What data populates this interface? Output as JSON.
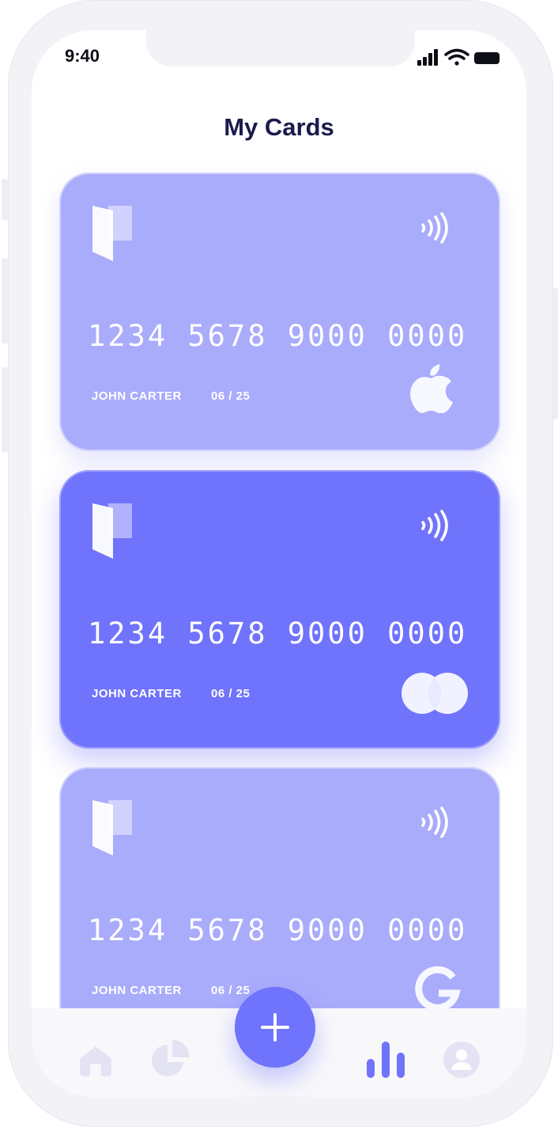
{
  "status_bar": {
    "time": "9:40"
  },
  "header": {
    "title": "My Cards"
  },
  "cards": [
    {
      "number": "1234 5678 9000 0000",
      "holder": "JOHN CARTER",
      "expiry": "06 / 25",
      "brand_icon": "apple-icon",
      "color": "#a9abfb"
    },
    {
      "number": "1234 5678 9000 0000",
      "holder": "JOHN CARTER",
      "expiry": "06 / 25",
      "brand_icon": "mastercard-icon",
      "color": "#7073fb"
    },
    {
      "number": "1234 5678 9000 0000",
      "holder": "JOHN CARTER",
      "expiry": "06 / 25",
      "brand_icon": "google-icon",
      "color": "#a9abfb"
    }
  ],
  "bottom_nav": {
    "items": [
      "home-icon",
      "pie-chart-icon",
      "add-icon",
      "bar-chart-icon",
      "profile-icon"
    ],
    "active": "bar-chart-icon"
  },
  "colors": {
    "accent": "#7073fb",
    "accent_light": "#a9abfb",
    "icon_inactive": "#e3e3f4",
    "title": "#1b1a4c"
  }
}
